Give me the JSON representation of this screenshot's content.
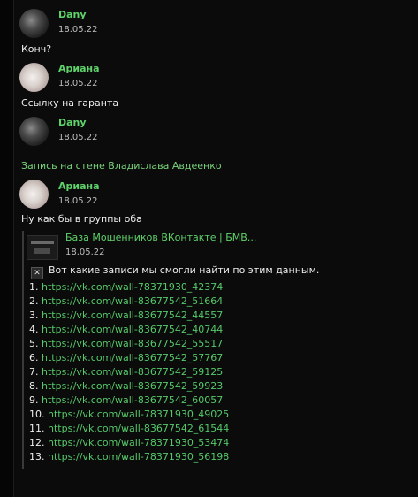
{
  "messages": [
    {
      "author": "Dany",
      "date": "18.05.22",
      "text": "Конч?",
      "avatar": "dark"
    },
    {
      "author": "Ариана",
      "date": "18.05.22",
      "text": "Ссылку на гаранта",
      "avatar": "light"
    },
    {
      "author": "Dany",
      "date": "18.05.22",
      "text": "Запись на стене Владислава Авдеенко",
      "avatar": "dark"
    },
    {
      "author": "Ариана",
      "date": "18.05.22",
      "text": "Ну как бы в группы оба",
      "avatar": "light"
    }
  ],
  "quote": {
    "name": "База Мошенников ВКонтакте | БМВ...",
    "date": "18.05.22",
    "header_icon": "cross-mark-icon",
    "header": "Вот какие записи мы смогли найти по этим данным.",
    "links": [
      {
        "num": "1.",
        "url": "https://vk.com/wall-78371930_42374"
      },
      {
        "num": "2.",
        "url": "https://vk.com/wall-83677542_51664"
      },
      {
        "num": "3.",
        "url": "https://vk.com/wall-83677542_44557"
      },
      {
        "num": "4.",
        "url": "https://vk.com/wall-83677542_40744"
      },
      {
        "num": "5.",
        "url": "https://vk.com/wall-83677542_55517"
      },
      {
        "num": "6.",
        "url": "https://vk.com/wall-83677542_57767"
      },
      {
        "num": "7.",
        "url": "https://vk.com/wall-83677542_59125"
      },
      {
        "num": "8.",
        "url": "https://vk.com/wall-83677542_59923"
      },
      {
        "num": "9.",
        "url": "https://vk.com/wall-83677542_60057"
      },
      {
        "num": "10.",
        "url": "https://vk.com/wall-78371930_49025"
      },
      {
        "num": "11.",
        "url": "https://vk.com/wall-83677542_61544"
      },
      {
        "num": "12.",
        "url": "https://vk.com/wall-78371930_53474"
      },
      {
        "num": "13.",
        "url": "https://vk.com/wall-78371930_56198"
      }
    ]
  },
  "colors": {
    "accent": "#5fd36b",
    "background": "#0b0b0b",
    "text": "#ededed"
  }
}
